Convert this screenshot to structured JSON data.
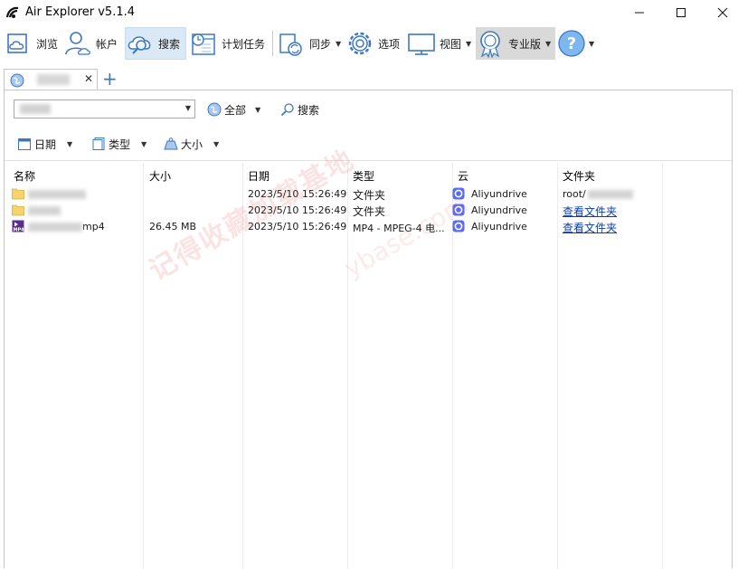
{
  "window": {
    "title": "Air Explorer v5.1.4"
  },
  "toolbar": {
    "browse": "浏览",
    "accounts": "帐户",
    "search": "搜索",
    "scheduler": "计划任务",
    "sync": "同步",
    "options": "选项",
    "view": "视图",
    "pro": "专业版"
  },
  "filters": {
    "all": "全部",
    "search": "搜索"
  },
  "sort": {
    "date": "日期",
    "type": "类型",
    "size": "大小"
  },
  "table": {
    "headers": {
      "name": "名称",
      "size": "大小",
      "date": "日期",
      "type": "类型",
      "cloud": "云",
      "folder": "文件夹"
    },
    "rows": [
      {
        "name_suffix": "",
        "size": "",
        "date": "2023/5/10 15:26:49",
        "type": "文件夹",
        "cloud": "Aliyundrive",
        "folder": "root/",
        "folder_is_link": false
      },
      {
        "name_suffix": "",
        "size": "",
        "date": "2023/5/10 15:26:49",
        "type": "文件夹",
        "cloud": "Aliyundrive",
        "folder": "查看文件夹",
        "folder_is_link": true
      },
      {
        "name_suffix": "mp4",
        "size": "26.45 MB",
        "date": "2023/5/10 15:26:49",
        "type": "MP4 - MPEG-4 电...",
        "cloud": "Aliyundrive",
        "folder": "查看文件夹",
        "folder_is_link": true
      }
    ]
  },
  "watermark": {
    "cn": "记得收藏加载基地",
    "en": "ybase.com"
  },
  "colors": {
    "accent": "#3b78c4",
    "cloud_icon": "#5b6cf0",
    "folder": "#f6d46b",
    "link": "#0a3ea8",
    "pro_bg": "#d9d9d9"
  }
}
